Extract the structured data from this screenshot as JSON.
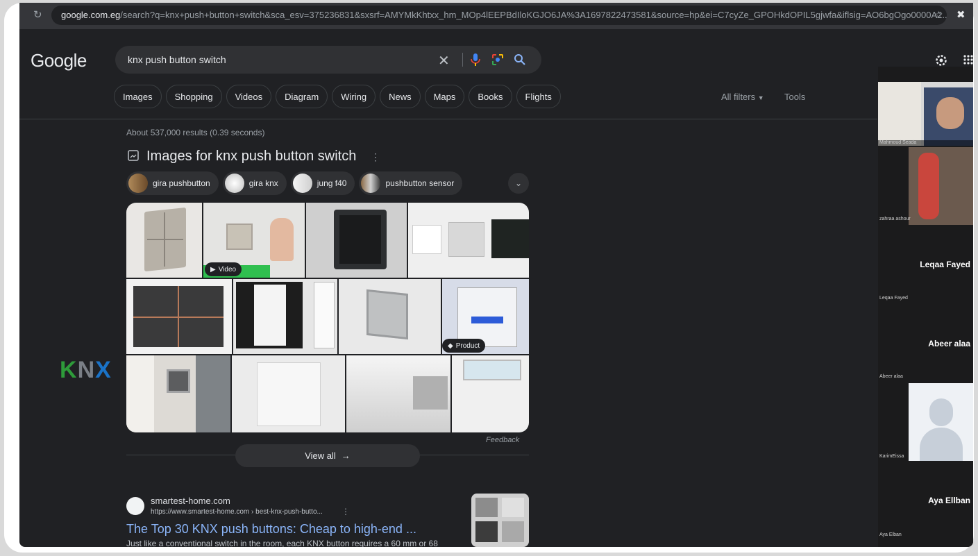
{
  "browser": {
    "url_domain": "google.com.eg",
    "url_rest": "/search?q=knx+push+button+switch&sca_esv=375236831&sxsrf=AMYMkKhtxx_hm_MOp4lEEPBdIloKGJO6JA%3A1697822473581&source=hp&ei=C7cyZe_GPOHkdOPIL5gjwfa&iflsig=AO6bgOgo0000A2..."
  },
  "google": {
    "logo": "Google",
    "query": "knx push button switch",
    "tabs": [
      "Images",
      "Shopping",
      "Videos",
      "Diagram",
      "Wiring",
      "News",
      "Maps",
      "Books",
      "Flights"
    ],
    "all_filters": "All filters",
    "tools": "Tools",
    "results_count": "About 537,000 results (0.39 seconds)",
    "images_heading": "Images for knx push button switch",
    "refinements": [
      {
        "label": "gira pushbutton",
        "color": "#8a6a45"
      },
      {
        "label": "gira knx",
        "color": "#e6e6e6"
      },
      {
        "label": "jung f40",
        "color": "#eeeeee"
      },
      {
        "label": "pushbutton sensor",
        "color": "#5a5a5a"
      }
    ],
    "badge_video": "Video",
    "badge_product": "Product",
    "feedback": "Feedback",
    "view_all": "View all",
    "result": {
      "site": "smartest-home.com",
      "url": "https://www.smartest-home.com › best-knx-push-butto...",
      "title": "The Top 30 KNX push buttons: Cheap to high-end ...",
      "snippet": "Just like a conventional switch in the room, each KNX button requires a 60 mm or 68"
    }
  },
  "participants": [
    {
      "name": "Mahmoud Seada",
      "kind": "video"
    },
    {
      "name": "zahraa ashour",
      "kind": "video"
    },
    {
      "name": "Leqaa Fayed",
      "kind": "name"
    },
    {
      "name": "Abeer alaa",
      "kind": "name"
    },
    {
      "name": "KarimEissa",
      "kind": "avatar"
    },
    {
      "name": "Aya Elban",
      "kind": "name"
    }
  ],
  "participant_big_names": {
    "leqaa": "Leqaa Fayed",
    "abeer": "Abeer alaa",
    "aya": "Aya Ellban"
  },
  "watermark": {
    "k": "K",
    "n": "N",
    "x": "X",
    "colors": {
      "k": "#2e9b3a",
      "n": "#7a7f86",
      "x": "#1a73c8"
    }
  }
}
